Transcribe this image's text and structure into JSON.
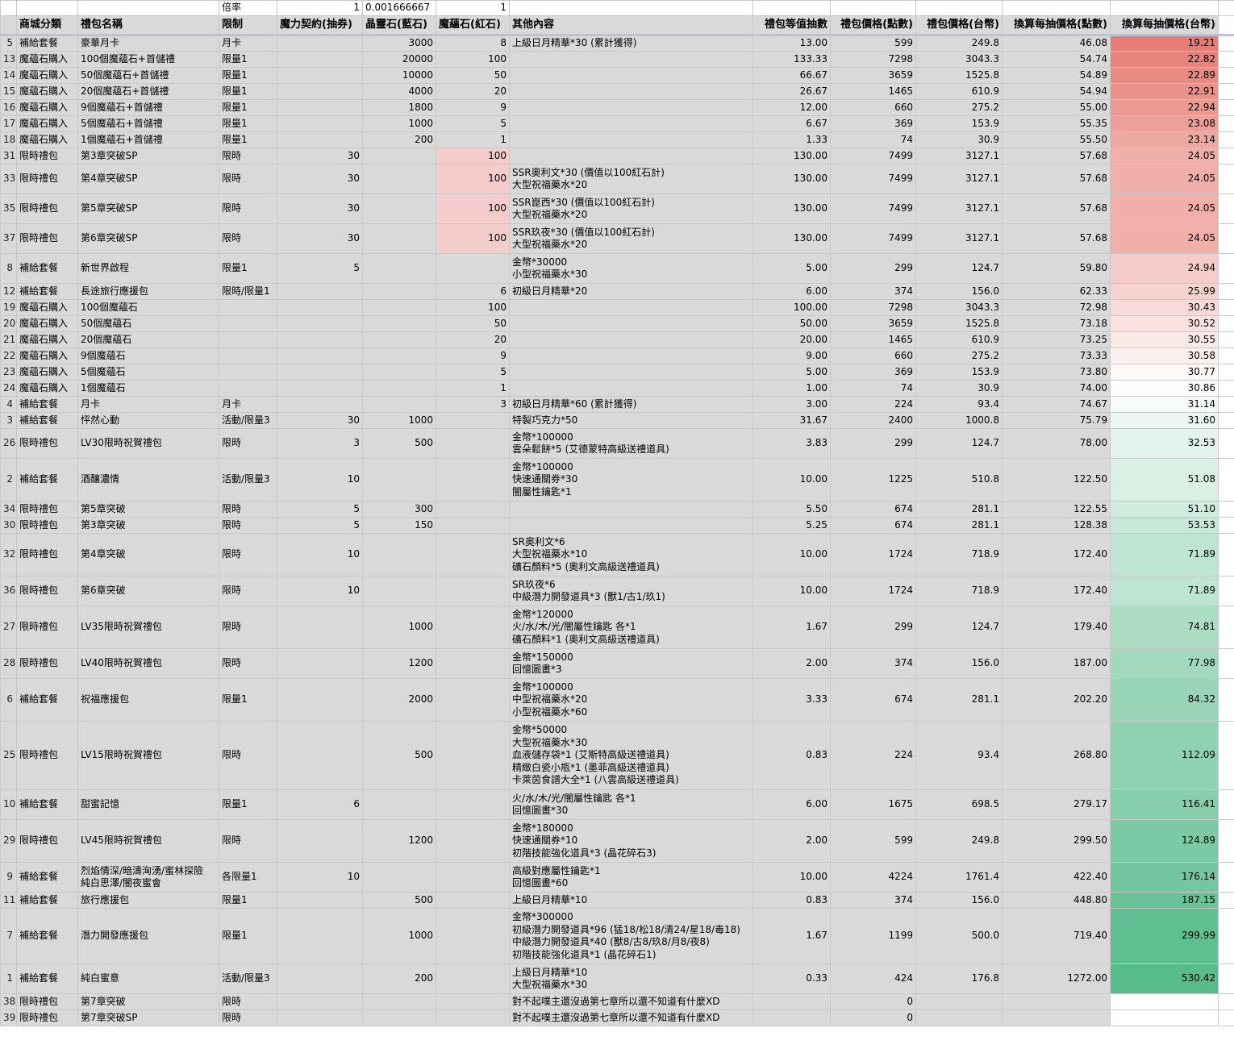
{
  "top_row": {
    "label": "倍率",
    "d": "1",
    "e": "0.001666667",
    "f": "1"
  },
  "headers": [
    "商城分類",
    "禮包名稱",
    "限制",
    "魔力契約(抽券)",
    "晶靈石(藍石)",
    "魔蘊石(紅石)",
    "其他內容",
    "禮包等值抽數",
    "禮包價格(點數)",
    "禮包價格(台幣)",
    "換算每抽價格(點數)",
    "換算每抽價格(台幣)"
  ],
  "heat_colors": {
    "low": "#e67c73",
    "mid": "#ffffff",
    "high": "#57bb8a"
  },
  "rows": [
    {
      "id": "5",
      "cat": "補給套餐",
      "name": "豪華月卡",
      "limit": "月卡",
      "ticket": "",
      "blue": "3000",
      "red": "8",
      "other": "上級日月精華*30 (累計獲得)",
      "eq": "13.00",
      "pts": "599",
      "twd": "249.8",
      "ppts": "46.08",
      "ptwd": "19.21"
    },
    {
      "id": "13",
      "cat": "魔蘊石購入",
      "name": "100個魔蘊石+首儲禮",
      "limit": "限量1",
      "ticket": "",
      "blue": "20000",
      "red": "100",
      "other": "",
      "eq": "133.33",
      "pts": "7298",
      "twd": "3043.3",
      "ppts": "54.74",
      "ptwd": "22.82"
    },
    {
      "id": "14",
      "cat": "魔蘊石購入",
      "name": "50個魔蘊石+首儲禮",
      "limit": "限量1",
      "ticket": "",
      "blue": "10000",
      "red": "50",
      "other": "",
      "eq": "66.67",
      "pts": "3659",
      "twd": "1525.8",
      "ppts": "54.89",
      "ptwd": "22.89"
    },
    {
      "id": "15",
      "cat": "魔蘊石購入",
      "name": "20個魔蘊石+首儲禮",
      "limit": "限量1",
      "ticket": "",
      "blue": "4000",
      "red": "20",
      "other": "",
      "eq": "26.67",
      "pts": "1465",
      "twd": "610.9",
      "ppts": "54.94",
      "ptwd": "22.91"
    },
    {
      "id": "16",
      "cat": "魔蘊石購入",
      "name": "9個魔蘊石+首儲禮",
      "limit": "限量1",
      "ticket": "",
      "blue": "1800",
      "red": "9",
      "other": "",
      "eq": "12.00",
      "pts": "660",
      "twd": "275.2",
      "ppts": "55.00",
      "ptwd": "22.94"
    },
    {
      "id": "17",
      "cat": "魔蘊石購入",
      "name": "5個魔蘊石+首儲禮",
      "limit": "限量1",
      "ticket": "",
      "blue": "1000",
      "red": "5",
      "other": "",
      "eq": "6.67",
      "pts": "369",
      "twd": "153.9",
      "ppts": "55.35",
      "ptwd": "23.08"
    },
    {
      "id": "18",
      "cat": "魔蘊石購入",
      "name": "1個魔蘊石+首儲禮",
      "limit": "限量1",
      "ticket": "",
      "blue": "200",
      "red": "1",
      "other": "",
      "eq": "1.33",
      "pts": "74",
      "twd": "30.9",
      "ppts": "55.50",
      "ptwd": "23.14"
    },
    {
      "id": "31",
      "cat": "限時禮包",
      "name": "第3章突破SP",
      "limit": "限時",
      "ticket": "30",
      "blue": "",
      "red": "100",
      "redPink": true,
      "other": "",
      "eq": "130.00",
      "pts": "7499",
      "twd": "3127.1",
      "ppts": "57.68",
      "ptwd": "24.05"
    },
    {
      "id": "33",
      "cat": "限時禮包",
      "name": "第4章突破SP",
      "limit": "限時",
      "ticket": "30",
      "blue": "",
      "red": "100",
      "redPink": true,
      "other": "SSR奧利文*30 (價值以100紅石計)\n大型祝福藥水*20",
      "eq": "130.00",
      "pts": "7499",
      "twd": "3127.1",
      "ppts": "57.68",
      "ptwd": "24.05"
    },
    {
      "id": "35",
      "cat": "限時禮包",
      "name": "第5章突破SP",
      "limit": "限時",
      "ticket": "30",
      "blue": "",
      "red": "100",
      "redPink": true,
      "other": "SSR崑西*30 (價值以100紅石計)\n大型祝福藥水*20",
      "eq": "130.00",
      "pts": "7499",
      "twd": "3127.1",
      "ppts": "57.68",
      "ptwd": "24.05"
    },
    {
      "id": "37",
      "cat": "限時禮包",
      "name": "第6章突破SP",
      "limit": "限時",
      "ticket": "30",
      "blue": "",
      "red": "100",
      "redPink": true,
      "other": "SSR玖夜*30 (價值以100紅石計)\n大型祝福藥水*20",
      "eq": "130.00",
      "pts": "7499",
      "twd": "3127.1",
      "ppts": "57.68",
      "ptwd": "24.05"
    },
    {
      "id": "8",
      "cat": "補給套餐",
      "name": "新世界啟程",
      "limit": "限量1",
      "ticket": "5",
      "blue": "",
      "red": "",
      "other": "金幣*30000\n小型祝福藥水*30",
      "eq": "5.00",
      "pts": "299",
      "twd": "124.7",
      "ppts": "59.80",
      "ptwd": "24.94"
    },
    {
      "id": "12",
      "cat": "補給套餐",
      "name": "長途旅行應援包",
      "limit": "限時/限量1",
      "ticket": "",
      "blue": "",
      "red": "6",
      "other": "初級日月精華*20",
      "eq": "6.00",
      "pts": "374",
      "twd": "156.0",
      "ppts": "62.33",
      "ptwd": "25.99"
    },
    {
      "id": "19",
      "cat": "魔蘊石購入",
      "name": "100個魔蘊石",
      "limit": "",
      "ticket": "",
      "blue": "",
      "red": "100",
      "other": "",
      "eq": "100.00",
      "pts": "7298",
      "twd": "3043.3",
      "ppts": "72.98",
      "ptwd": "30.43"
    },
    {
      "id": "20",
      "cat": "魔蘊石購入",
      "name": "50個魔蘊石",
      "limit": "",
      "ticket": "",
      "blue": "",
      "red": "50",
      "other": "",
      "eq": "50.00",
      "pts": "3659",
      "twd": "1525.8",
      "ppts": "73.18",
      "ptwd": "30.52"
    },
    {
      "id": "21",
      "cat": "魔蘊石購入",
      "name": "20個魔蘊石",
      "limit": "",
      "ticket": "",
      "blue": "",
      "red": "20",
      "other": "",
      "eq": "20.00",
      "pts": "1465",
      "twd": "610.9",
      "ppts": "73.25",
      "ptwd": "30.55"
    },
    {
      "id": "22",
      "cat": "魔蘊石購入",
      "name": "9個魔蘊石",
      "limit": "",
      "ticket": "",
      "blue": "",
      "red": "9",
      "other": "",
      "eq": "9.00",
      "pts": "660",
      "twd": "275.2",
      "ppts": "73.33",
      "ptwd": "30.58"
    },
    {
      "id": "23",
      "cat": "魔蘊石購入",
      "name": "5個魔蘊石",
      "limit": "",
      "ticket": "",
      "blue": "",
      "red": "5",
      "other": "",
      "eq": "5.00",
      "pts": "369",
      "twd": "153.9",
      "ppts": "73.80",
      "ptwd": "30.77"
    },
    {
      "id": "24",
      "cat": "魔蘊石購入",
      "name": "1個魔蘊石",
      "limit": "",
      "ticket": "",
      "blue": "",
      "red": "1",
      "other": "",
      "eq": "1.00",
      "pts": "74",
      "twd": "30.9",
      "ppts": "74.00",
      "ptwd": "30.86"
    },
    {
      "id": "4",
      "cat": "補給套餐",
      "name": "月卡",
      "limit": "月卡",
      "ticket": "",
      "blue": "",
      "red": "3",
      "other": "初級日月精華*60 (累計獲得)",
      "eq": "3.00",
      "pts": "224",
      "twd": "93.4",
      "ppts": "74.67",
      "ptwd": "31.14"
    },
    {
      "id": "3",
      "cat": "補給套餐",
      "name": "怦然心動",
      "limit": "活動/限量3",
      "ticket": "30",
      "blue": "1000",
      "red": "",
      "other": "特製巧克力*50",
      "eq": "31.67",
      "pts": "2400",
      "twd": "1000.8",
      "ppts": "75.79",
      "ptwd": "31.60"
    },
    {
      "id": "26",
      "cat": "限時禮包",
      "name": "LV30限時祝賀禮包",
      "limit": "限時",
      "ticket": "3",
      "blue": "500",
      "red": "",
      "other": "金幣*100000\n雲朵鬆餅*5 (艾德蒙特高級送禮道具)",
      "eq": "3.83",
      "pts": "299",
      "twd": "124.7",
      "ppts": "78.00",
      "ptwd": "32.53"
    },
    {
      "id": "2",
      "cat": "補給套餐",
      "name": "酒釀濃情",
      "limit": "活動/限量3",
      "ticket": "10",
      "blue": "",
      "red": "",
      "other": "金幣*100000\n快速通關券*30\n闇屬性鑰匙*1",
      "eq": "10.00",
      "pts": "1225",
      "twd": "510.8",
      "ppts": "122.50",
      "ptwd": "51.08"
    },
    {
      "id": "34",
      "cat": "限時禮包",
      "name": "第5章突破",
      "limit": "限時",
      "ticket": "5",
      "blue": "300",
      "red": "",
      "other": "",
      "eq": "5.50",
      "pts": "674",
      "twd": "281.1",
      "ppts": "122.55",
      "ptwd": "51.10"
    },
    {
      "id": "30",
      "cat": "限時禮包",
      "name": "第3章突破",
      "limit": "限時",
      "ticket": "5",
      "blue": "150",
      "red": "",
      "other": "",
      "eq": "5.25",
      "pts": "674",
      "twd": "281.1",
      "ppts": "128.38",
      "ptwd": "53.53"
    },
    {
      "id": "32",
      "cat": "限時禮包",
      "name": "第4章突破",
      "limit": "限時",
      "ticket": "10",
      "blue": "",
      "red": "",
      "other": "SR奧利文*6\n大型祝福藥水*10\n礦石顏料*5 (奧利文高級送禮道具)",
      "eq": "10.00",
      "pts": "1724",
      "twd": "718.9",
      "ppts": "172.40",
      "ptwd": "71.89"
    },
    {
      "id": "36",
      "cat": "限時禮包",
      "name": "第6章突破",
      "limit": "限時",
      "ticket": "10",
      "blue": "",
      "red": "",
      "other": "SR玖夜*6\n中級潛力開發道具*3 (獸1/古1/玖1)",
      "eq": "10.00",
      "pts": "1724",
      "twd": "718.9",
      "ppts": "172.40",
      "ptwd": "71.89"
    },
    {
      "id": "27",
      "cat": "限時禮包",
      "name": "LV35限時祝賀禮包",
      "limit": "限時",
      "ticket": "",
      "blue": "1000",
      "red": "",
      "other": "金幣*120000\n火/水/木/光/闇屬性鑰匙 各*1\n礦石顏料*1 (奧利文高級送禮道具)",
      "eq": "1.67",
      "pts": "299",
      "twd": "124.7",
      "ppts": "179.40",
      "ptwd": "74.81"
    },
    {
      "id": "28",
      "cat": "限時禮包",
      "name": "LV40限時祝賀禮包",
      "limit": "限時",
      "ticket": "",
      "blue": "1200",
      "red": "",
      "other": "金幣*150000\n回憶圖畫*3",
      "eq": "2.00",
      "pts": "374",
      "twd": "156.0",
      "ppts": "187.00",
      "ptwd": "77.98"
    },
    {
      "id": "6",
      "cat": "補給套餐",
      "name": "祝福應援包",
      "limit": "限量1",
      "ticket": "",
      "blue": "2000",
      "red": "",
      "other": "金幣*100000\n中型祝福藥水*20\n小型祝福藥水*60",
      "eq": "3.33",
      "pts": "674",
      "twd": "281.1",
      "ppts": "202.20",
      "ptwd": "84.32"
    },
    {
      "id": "25",
      "cat": "限時禮包",
      "name": "LV15限時祝賀禮包",
      "limit": "限時",
      "ticket": "",
      "blue": "500",
      "red": "",
      "other": "金幣*50000\n大型祝福藥水*30\n血液儲存袋*1 (艾斯特高級送禮道具)\n精緻白瓷小瓶*1 (墨菲高級送禮道具)\n卡萊茵食譜大全*1 (八雲高級送禮道具)",
      "eq": "0.83",
      "pts": "224",
      "twd": "93.4",
      "ppts": "268.80",
      "ptwd": "112.09"
    },
    {
      "id": "10",
      "cat": "補給套餐",
      "name": "甜蜜記憶",
      "limit": "限量1",
      "ticket": "6",
      "blue": "",
      "red": "",
      "other": "火/水/木/光/闇屬性鑰匙 各*1\n回憶圖畫*30",
      "eq": "6.00",
      "pts": "1675",
      "twd": "698.5",
      "ppts": "279.17",
      "ptwd": "116.41"
    },
    {
      "id": "29",
      "cat": "限時禮包",
      "name": "LV45限時祝賀禮包",
      "limit": "限時",
      "ticket": "",
      "blue": "1200",
      "red": "",
      "other": "金幣*180000\n快速通關券*10\n初階技能強化道具*3 (晶花碎石3)",
      "eq": "2.00",
      "pts": "599",
      "twd": "249.8",
      "ppts": "299.50",
      "ptwd": "124.89"
    },
    {
      "id": "9",
      "cat": "補給套餐",
      "name": "烈焰情深/暗濤洶湧/蜜林探險\n純白思澤/闇夜蜜會",
      "limit": "各限量1",
      "ticket": "10",
      "blue": "",
      "red": "",
      "other": "高級對應屬性鑰匙*1\n回憶圖畫*60",
      "eq": "10.00",
      "pts": "4224",
      "twd": "1761.4",
      "ppts": "422.40",
      "ptwd": "176.14"
    },
    {
      "id": "11",
      "cat": "補給套餐",
      "name": "旅行應援包",
      "limit": "限量1",
      "ticket": "",
      "blue": "500",
      "red": "",
      "other": "上級日月精華*10",
      "eq": "0.83",
      "pts": "374",
      "twd": "156.0",
      "ppts": "448.80",
      "ptwd": "187.15"
    },
    {
      "id": "7",
      "cat": "補給套餐",
      "name": "潛力開發應援包",
      "limit": "限量1",
      "ticket": "",
      "blue": "1000",
      "red": "",
      "other": "金幣*300000\n初級潛力開發道具*96 (猛18/松18/清24/星18/毒18)\n中級潛力開發道具*40 (獸8/古8/玖8/月8/夜8)\n初階技能強化道具*1 (晶花碎石1)",
      "eq": "1.67",
      "pts": "1199",
      "twd": "500.0",
      "ppts": "719.40",
      "ptwd": "299.99"
    },
    {
      "id": "1",
      "cat": "補給套餐",
      "name": "純白蜜意",
      "limit": "活動/限量3",
      "ticket": "",
      "blue": "200",
      "red": "",
      "other": "上級日月精華*10\n大型祝福藥水*30",
      "eq": "0.33",
      "pts": "424",
      "twd": "176.8",
      "ppts": "1272.00",
      "ptwd": "530.42"
    },
    {
      "id": "38",
      "cat": "限時禮包",
      "name": "第7章突破",
      "limit": "限時",
      "ticket": "",
      "blue": "",
      "red": "",
      "other": "對不起噗主還沒過第七章所以還不知道有什麼XD",
      "eq": "",
      "pts": "0",
      "twd": "",
      "ppts": "",
      "ptwd": ""
    },
    {
      "id": "39",
      "cat": "限時禮包",
      "name": "第7章突破SP",
      "limit": "限時",
      "ticket": "",
      "blue": "",
      "red": "",
      "other": "對不起噗主還沒過第七章所以還不知道有什麼XD",
      "eq": "",
      "pts": "0",
      "twd": "",
      "ppts": "",
      "ptwd": ""
    }
  ]
}
